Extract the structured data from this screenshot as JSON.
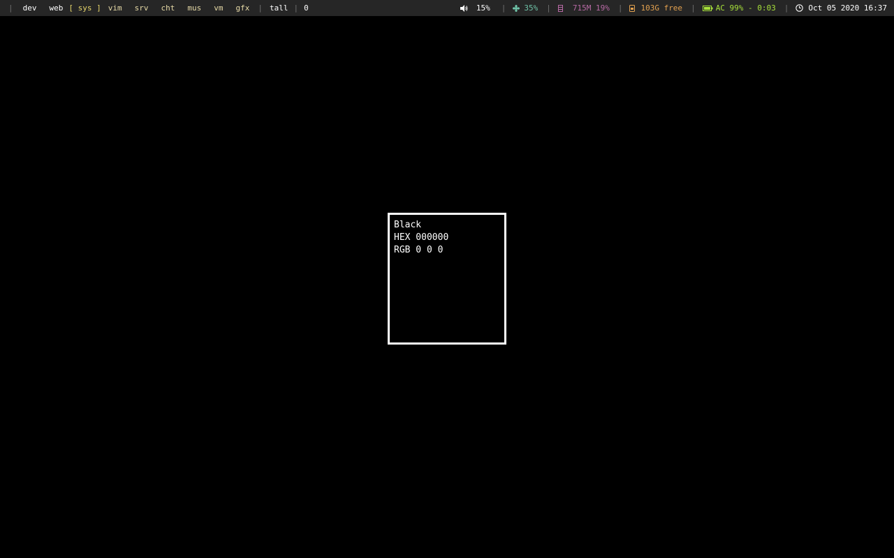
{
  "statusbar": {
    "leading_sep": "|",
    "workspaces": [
      {
        "label": "dev",
        "style": "plain"
      },
      {
        "label": "web",
        "style": "plain"
      },
      {
        "label": "sys",
        "style": "current"
      },
      {
        "label": "vim",
        "style": "normal"
      },
      {
        "label": "srv",
        "style": "normal"
      },
      {
        "label": "cht",
        "style": "normal"
      },
      {
        "label": "mus",
        "style": "normal"
      },
      {
        "label": "vm",
        "style": "normal"
      },
      {
        "label": "gfx",
        "style": "normal"
      }
    ],
    "current_open": "[",
    "current_close": "]",
    "layout": "tall",
    "window_count": "0",
    "volume": {
      "icon": "speaker-icon",
      "value": "15%"
    },
    "cpu": {
      "icon": "fan-icon",
      "value": "35%"
    },
    "memory": {
      "icon": "memory-icon",
      "value": "715M 19%"
    },
    "disk": {
      "icon": "disk-icon",
      "value": "103G free"
    },
    "battery": {
      "icon": "battery-icon",
      "value": "AC 99% - 0:03",
      "level": 0.99
    },
    "clock": {
      "icon": "clock-icon",
      "value": "Oct 05 2020 16:37"
    },
    "separator": "|",
    "colors": {
      "bar_bg": "#262626",
      "workspace": "#e6d9a6",
      "current": "#e6d56a",
      "cpu": "#6fc3a8",
      "memory": "#b86aa5",
      "disk": "#e4a250",
      "battery": "#a8e23a"
    }
  },
  "popup": {
    "name": "Black",
    "hex_line": "HEX 000000",
    "rgb_line": "RGB 0 0 0"
  }
}
